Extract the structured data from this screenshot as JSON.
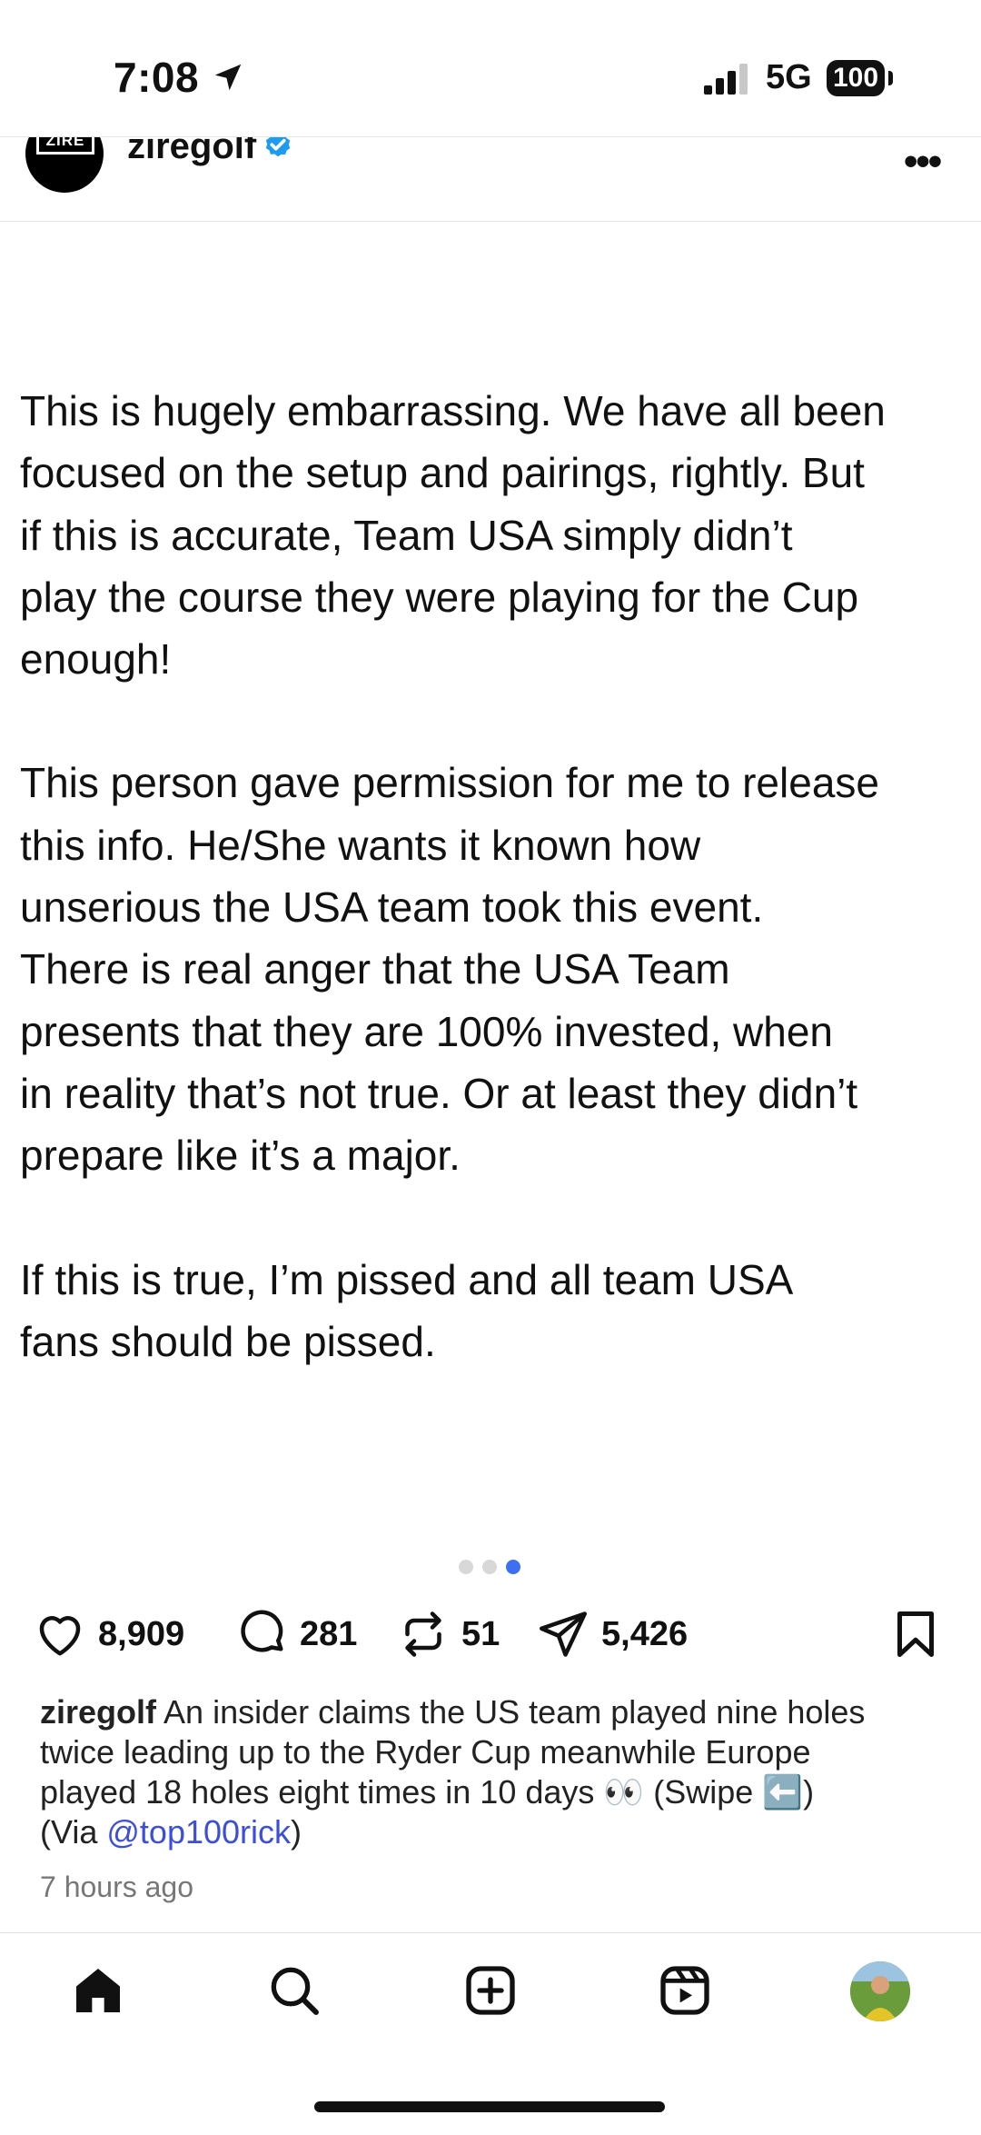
{
  "status_bar": {
    "time": "7:08",
    "network": "5G",
    "battery": "100"
  },
  "post": {
    "avatar_logo": "ZIRE",
    "username": "ziregolf",
    "more": "•••",
    "slide_paragraphs": [
      "This is hugely embarrassing. We have all been\nfocused on the setup and pairings, rightly. But\nif this is accurate, Team USA simply didn’t\nplay the course they were playing for the Cup\nenough!",
      "This person gave permission for me to release\nthis info. He/She wants it known how\nunserious the USA team took this event.\nThere is real anger that the USA Team\npresents that they are 100% invested, when\nin reality that’s not true. Or at least they didn’t\nprepare like it’s a major.",
      "If this is true, I’m pissed and all team USA\nfans should be pissed."
    ],
    "carousel": {
      "total": 3,
      "active_index": 2
    },
    "actions": {
      "likes": "8,909",
      "comments": "281",
      "reposts": "51",
      "shares": "5,426"
    },
    "caption": {
      "username": "ziregolf",
      "line1": "An insider claims the US team played nine holes",
      "line2": "twice leading up to the Ryder Cup meanwhile Europe",
      "line3": "played 18 holes eight times in 10 days 👀 (Swipe ⬅️)",
      "via_prefix": "(Via ",
      "via_mention": "@top100rick",
      "via_suffix": ")"
    },
    "timestamp": "7 hours ago"
  },
  "bottom_nav": [
    "home",
    "search",
    "create",
    "reels",
    "profile"
  ],
  "colors": {
    "accent_blue": "#3d6ff0",
    "mention_blue": "#3c4fd6",
    "verified_blue": "#1d9bf0"
  }
}
